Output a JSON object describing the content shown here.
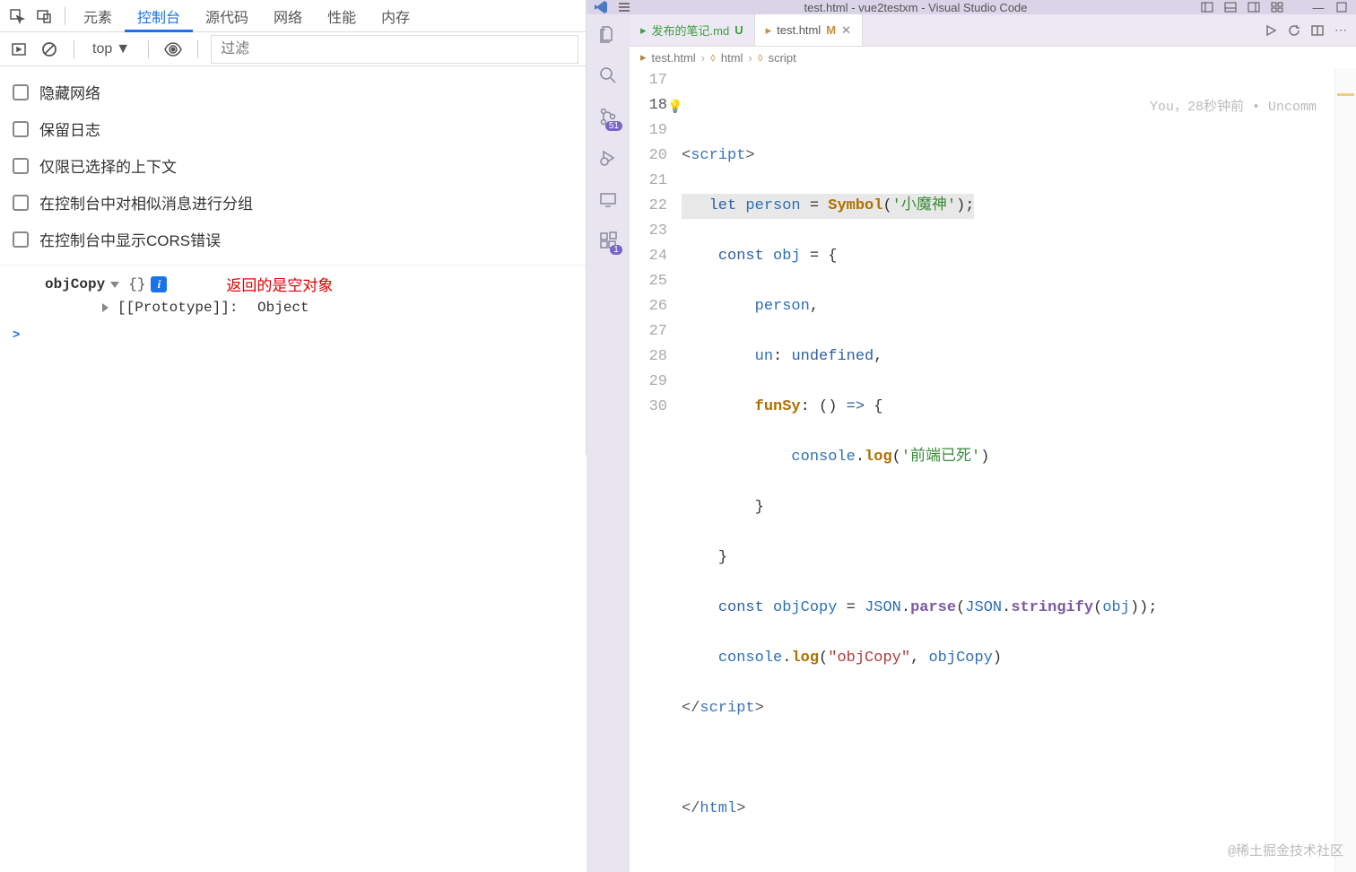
{
  "devtools": {
    "tabs": [
      "元素",
      "控制台",
      "源代码",
      "网络",
      "性能",
      "内存"
    ],
    "active_tab": "控制台",
    "toolbar": {
      "context": "top",
      "filter_placeholder": "过滤"
    },
    "settings": [
      "隐藏网络",
      "保留日志",
      "仅限已选择的上下文",
      "在控制台中对相似消息进行分组",
      "在控制台中显示CORS错误"
    ],
    "output": {
      "var_name": "objCopy",
      "empty_obj": "{}",
      "proto_label": "[[Prototype]]:",
      "proto_value": "Object",
      "annotation": "返回的是空对象",
      "prompt": ">"
    }
  },
  "vscode": {
    "titlebar": "test.html - vue2testxm - Visual Studio Code",
    "activity_badges": {
      "scm": "51",
      "ext": "1"
    },
    "tabs": [
      {
        "name": "发布的笔记.md",
        "status": "U",
        "active": false
      },
      {
        "name": "test.html",
        "status": "M",
        "active": true
      }
    ],
    "breadcrumb": [
      "test.html",
      "html",
      "script"
    ],
    "line_start": 17,
    "current_line": 18,
    "codelens": "You，28秒钟前 • Uncomm",
    "code": {
      "l17": {
        "open": "<",
        "tag": "script",
        "close": ">"
      },
      "l18": {
        "kw": "let",
        "var": "person",
        "eq": " = ",
        "fn": "Symbol",
        "p1": "(",
        "str": "'小魔神'",
        "p2": ");"
      },
      "l19": {
        "kw": "const",
        "var": "obj",
        "rest": " = {"
      },
      "l20": {
        "prop": "person",
        "rest": ","
      },
      "l21": {
        "prop": "un",
        "colon": ": ",
        "val": "undefined",
        "rest": ","
      },
      "l22": {
        "prop": "funSy",
        "colon": ": () ",
        "arrow": "=>",
        "rest": " {"
      },
      "l23": {
        "obj": "console",
        "dot": ".",
        "fn": "log",
        "p1": "(",
        "str": "'前端已死'",
        "p2": ")"
      },
      "l24": {
        "brace": "}"
      },
      "l25": {
        "brace": "}"
      },
      "l26": {
        "kw": "const",
        "var": "objCopy",
        "eq": " = ",
        "obj1": "JSON",
        "d1": ".",
        "fn1": "parse",
        "p1": "(",
        "obj2": "JSON",
        "d2": ".",
        "fn2": "stringify",
        "p2": "(",
        "arg": "obj",
        "p3": "));"
      },
      "l27": {
        "obj": "console",
        "dot": ".",
        "fn": "log",
        "p1": "(",
        "str": "\"objCopy\"",
        "c": ", ",
        "arg": "objCopy",
        "p2": ")"
      },
      "l28": {
        "open": "</",
        "tag": "script",
        "close": ">"
      },
      "l29": "",
      "l30": {
        "open": "</",
        "tag": "html",
        "close": ">"
      }
    }
  },
  "watermark": "@稀土掘金技术社区"
}
